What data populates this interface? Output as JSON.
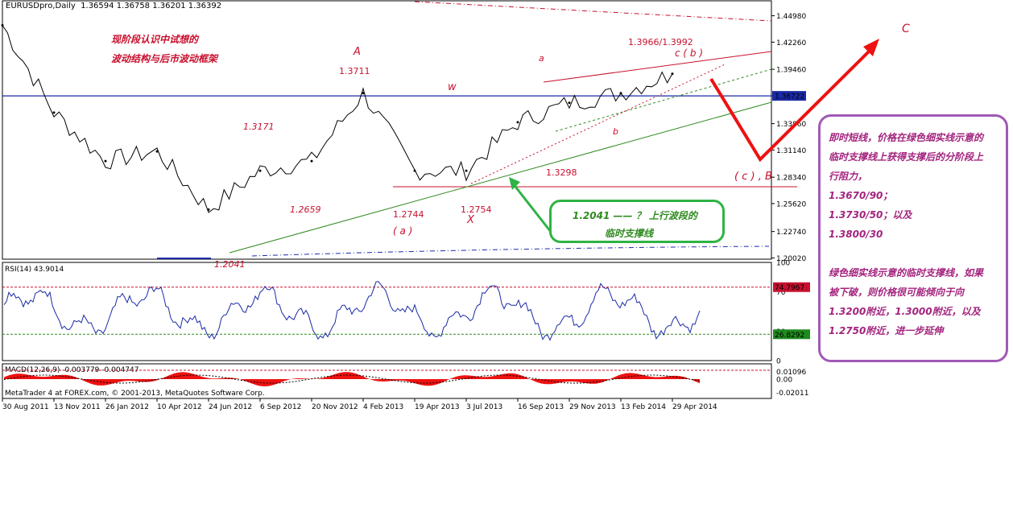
{
  "header": {
    "symbol": "EURUSDpro,Daily",
    "ohlc": "1.36594 1.36758 1.36201 1.36392"
  },
  "main_chart": {
    "price_ticks": [
      "1.44980",
      "1.42260",
      "1.39460",
      "1.36722",
      "1.33860",
      "1.31140",
      "1.28340",
      "1.25620",
      "1.22740",
      "1.20020"
    ],
    "current_price": "1.36722",
    "annotation_cn": [
      "现阶段认识中试想的",
      "波动结构与后市波动框架"
    ],
    "wave_labels": {
      "A": "A",
      "W": "w",
      "a_lower": "a",
      "b_lower": "b",
      "X": "X",
      "cb": "c ( b )",
      "a_paren": "( a )",
      "cB": "( c ) , B",
      "C": "C"
    },
    "price_labels": {
      "p13711": "1.3711",
      "p13171": "1.3171",
      "p12659": "1.2659",
      "p12744": "1.2744",
      "p12754": "1.2754",
      "p13298": "1.3298",
      "p12041": "1.2041",
      "p13966": "1.3966/1.3992"
    },
    "green_note": {
      "line1": "1.2041 —— ？ 上行波段的",
      "line2": "临时支撑线"
    },
    "purple_note": [
      "即时短线，价格在绿色细实线示意的",
      "临时支撑线上获得支撑后的分阶段上",
      "行阻力，",
      "1.3670/90；",
      "1.3730/50；以及",
      "1.3800/30",
      "",
      "绿色细实线示意的临时支撑线，如果",
      "被下破，则价格很可能倾向于向",
      "1.3200附近，1.3000附近，以及",
      "1.2750附近，进一步延伸"
    ]
  },
  "rsi": {
    "title": "RSI(14) 43.9014",
    "upper": "74.7967",
    "lower": "26.8292",
    "ticks": [
      "100",
      "70",
      "30",
      "0"
    ]
  },
  "macd": {
    "title": "MACD(12,26,9) -0.003779 -0.004747",
    "ticks": [
      "0.01096",
      "0.00",
      "-0.02011"
    ],
    "credit": "MetaTrader 4 at FOREX.com, © 2001-2013, MetaQuotes Software Corp."
  },
  "x_ticks": [
    "30 Aug 2011",
    "13 Nov 2011",
    "26 Jan 2012",
    "10 Apr 2012",
    "24 Jun 2012",
    "6 Sep 2012",
    "20 Nov 2012",
    "4 Feb 2013",
    "19 Apr 2013",
    "3 Jul 2013",
    "16 Sep 2013",
    "29 Nov 2013",
    "13 Feb 2014",
    "29 Apr 2014"
  ],
  "chart_data": {
    "type": "line",
    "series": [
      {
        "x": [
          "30 Aug 2011",
          "13 Nov 2011",
          "26 Jan 2012",
          "10 Apr 2012",
          "24 Jun 2012",
          "6 Sep 2012",
          "20 Nov 2012",
          "4 Feb 2013",
          "19 Apr 2013",
          "3 Jul 2013",
          "16 Sep 2013",
          "29 Nov 2013",
          "13 Feb 2014",
          "29 Apr 2014"
        ],
        "values": [
          1.44,
          1.35,
          1.3,
          1.31,
          1.25,
          1.29,
          1.3,
          1.37,
          1.29,
          1.29,
          1.34,
          1.36,
          1.37,
          1.39
        ]
      }
    ],
    "ylim": [
      1.1989,
      1.4652
    ],
    "colors": {
      "price": "#000000",
      "blue_line": "#1a2aa6",
      "red": "#c8102e",
      "green": "#2f8a1f"
    }
  }
}
